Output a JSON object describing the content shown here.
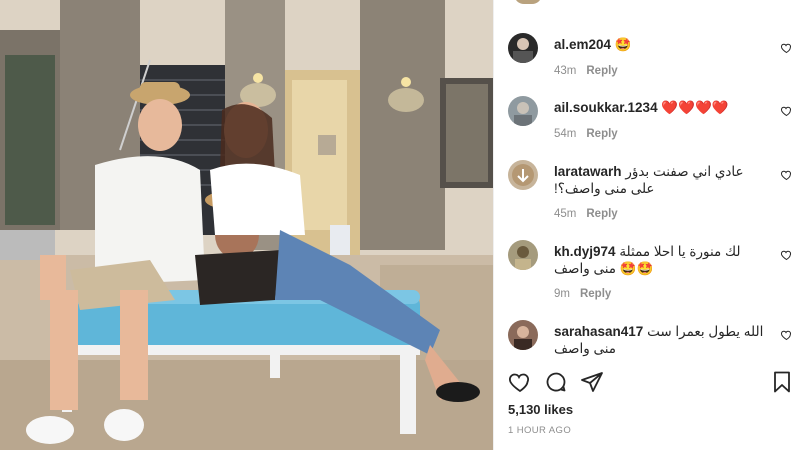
{
  "post": {
    "likes": "5,130 likes",
    "time_ago": "1 HOUR AGO"
  },
  "comments": [
    {
      "user": "al.em204",
      "text": "🤩",
      "rtl": false,
      "time": "43m",
      "reply": "Reply"
    },
    {
      "user": "ail.soukkar.1234",
      "text": "❤️❤️❤️❤️",
      "rtl": false,
      "time": "54m",
      "reply": "Reply"
    },
    {
      "user": "laratawarh",
      "text": "عادي اني صفنت بدؤر",
      "text2": "!على منى واصف؟",
      "rtl": true,
      "time": "45m",
      "reply": "Reply"
    },
    {
      "user": "kh.dyj974",
      "text": "لك منورة يا احلا ممثلة",
      "text2": "منى واصف 🤩🤩",
      "rtl": true,
      "time": "9m",
      "reply": "Reply"
    },
    {
      "user": "sarahasan417",
      "text": "الله يطول بعمرا ست",
      "text2": "منى واصف",
      "rtl": true,
      "time": "",
      "reply": ""
    }
  ],
  "icons": {
    "like": "heart-icon",
    "comment": "comment-icon",
    "share": "share-icon",
    "save": "bookmark-icon"
  },
  "colors": {
    "text": "#262626",
    "muted": "#8e8e8e",
    "sofa": "#5fb6d9"
  }
}
